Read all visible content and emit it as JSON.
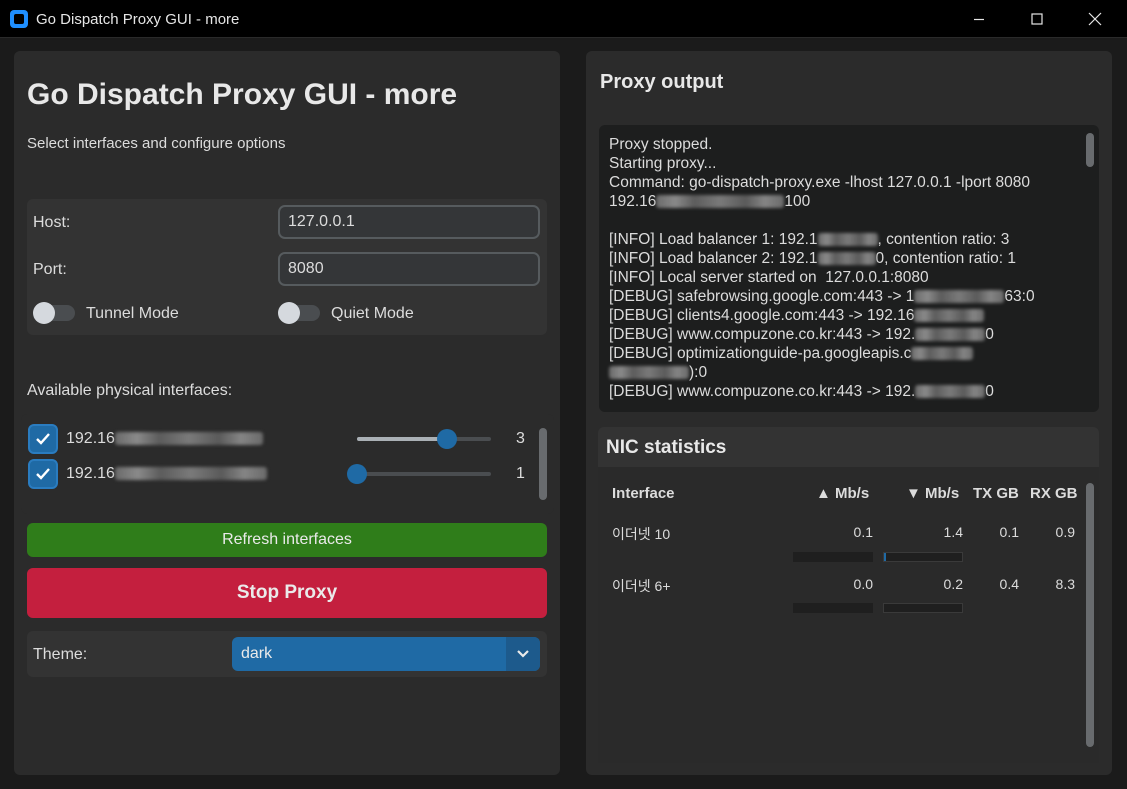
{
  "window": {
    "title": "Go Dispatch Proxy GUI - more"
  },
  "left": {
    "title": "Go Dispatch Proxy GUI - more",
    "subtitle": "Select interfaces and configure options",
    "host_label": "Host:",
    "host_value": "127.0.0.1",
    "port_label": "Port:",
    "port_value": "8080",
    "tunnel_label": "Tunnel Mode",
    "tunnel_on": false,
    "quiet_label": "Quiet Mode",
    "quiet_on": false,
    "interfaces_title": "Available physical interfaces:",
    "interfaces": [
      {
        "prefix": "192.16",
        "checked": true,
        "weight": 3,
        "slider_fraction": 0.67
      },
      {
        "prefix": "192.16",
        "checked": true,
        "weight": 1,
        "slider_fraction": 0.0
      }
    ],
    "refresh_label": "Refresh interfaces",
    "stop_label": "Stop Proxy",
    "theme_label": "Theme:",
    "theme_value": "dark"
  },
  "right": {
    "proxy_title": "Proxy output",
    "log": [
      {
        "a": "Proxy stopped.",
        "b": ""
      },
      {
        "a": "Starting proxy...",
        "b": ""
      },
      {
        "a": "Command: go-dispatch-proxy.exe -lhost 127.0.0.1 -lport 8080",
        "b": ""
      },
      {
        "a": "192.16",
        "b": "100"
      },
      {
        "a": "",
        "b": ""
      },
      {
        "a": "[INFO] Load balancer 1: 192.1",
        "b": ", contention ratio: 3"
      },
      {
        "a": "[INFO] Load balancer 2: 192.1",
        "b": "0, contention ratio: 1"
      },
      {
        "a": "[INFO] Local server started on  127.0.0.1:8080",
        "b": ""
      },
      {
        "a": "[DEBUG] safebrowsing.google.com:443 -> 1",
        "b": "63:0"
      },
      {
        "a": "[DEBUG] clients4.google.com:443 -> 192.16",
        "b": ""
      },
      {
        "a": "[DEBUG] www.compuzone.co.kr:443 -> 192.",
        "b": "0"
      },
      {
        "a": "[DEBUG] optimizationguide-pa.googleapis.c",
        "b": ""
      },
      {
        "a": "",
        "b": "):0"
      },
      {
        "a": "[DEBUG] www.compuzone.co.kr:443 -> 192.",
        "b": "0"
      }
    ],
    "nic_title": "NIC statistics",
    "nic_headers": [
      "Interface",
      "▲ Mb/s",
      "▼ Mb/s",
      "TX GB",
      "RX GB"
    ],
    "nic_rows": [
      {
        "name": "이더넷 10",
        "up": "0.1",
        "down": "1.4",
        "tx": "0.1",
        "rx": "0.9",
        "up_fraction": 0.0,
        "down_fraction": 0.03
      },
      {
        "name": "이더넷 6+",
        "up": "0.0",
        "down": "0.2",
        "tx": "0.4",
        "rx": "8.3",
        "up_fraction": 0.0,
        "down_fraction": 0.0
      }
    ]
  },
  "colors": {
    "accent": "#1f6aa5",
    "refresh": "#2f7d1a",
    "stop": "#c41f3e"
  }
}
